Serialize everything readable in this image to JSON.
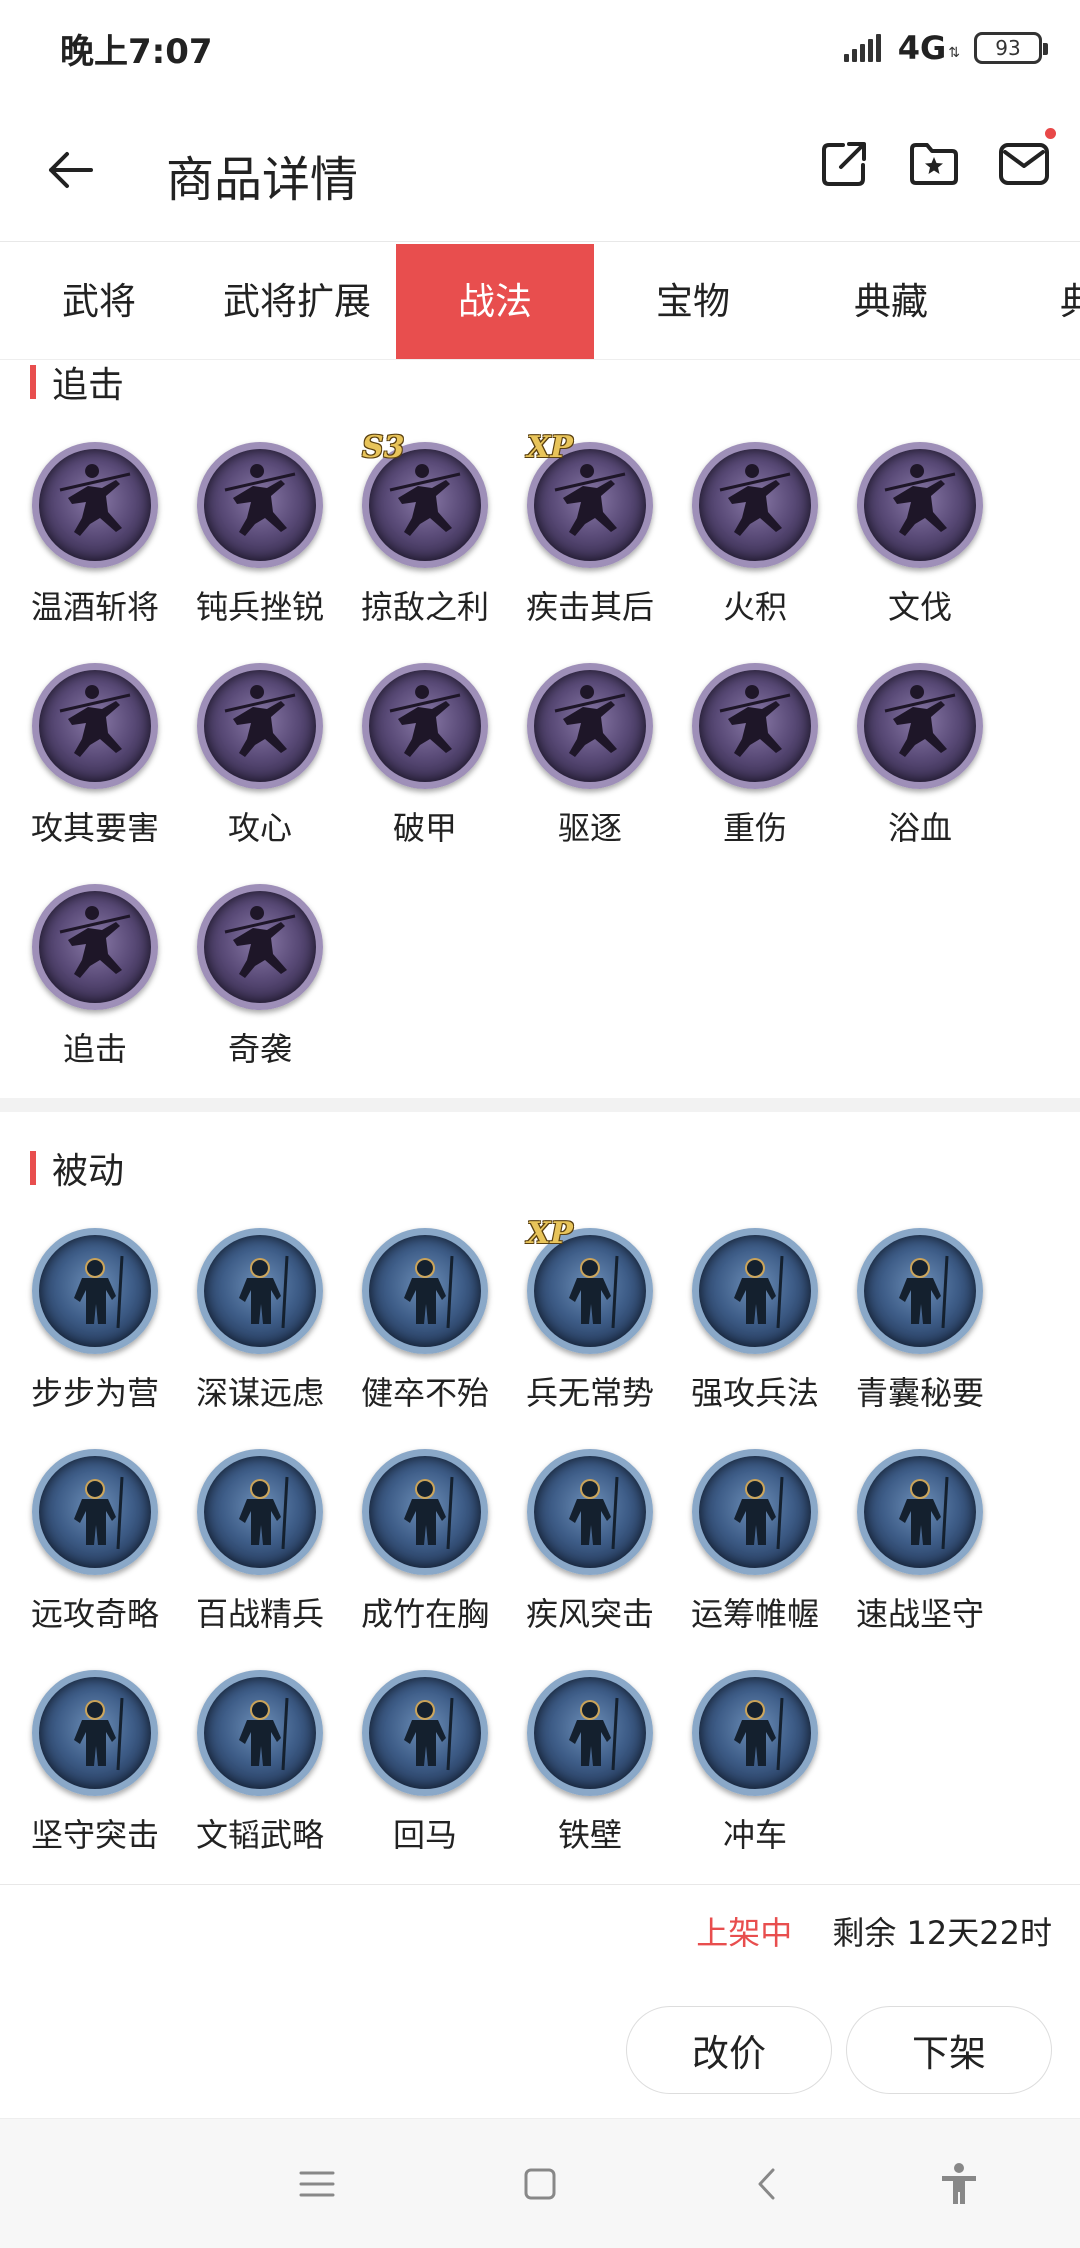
{
  "status_bar": {
    "time": "晚上7:07",
    "network": "4G",
    "battery": "93"
  },
  "header": {
    "title": "商品详情"
  },
  "tabs": [
    {
      "label": "武将"
    },
    {
      "label": "武将扩展"
    },
    {
      "label": "战法"
    },
    {
      "label": "宝物"
    },
    {
      "label": "典藏"
    },
    {
      "label": "典"
    }
  ],
  "active_tab": "战法",
  "sections": [
    {
      "title": "追击",
      "icon_color": "purple",
      "skills": [
        {
          "name": "温酒斩将",
          "badge": ""
        },
        {
          "name": "钝兵挫锐",
          "badge": ""
        },
        {
          "name": "掠敌之利",
          "badge": "S3"
        },
        {
          "name": "疾击其后",
          "badge": "XP"
        },
        {
          "name": "火积",
          "badge": ""
        },
        {
          "name": "文伐",
          "badge": ""
        },
        {
          "name": "攻其要害",
          "badge": ""
        },
        {
          "name": "攻心",
          "badge": ""
        },
        {
          "name": "破甲",
          "badge": ""
        },
        {
          "name": "驱逐",
          "badge": ""
        },
        {
          "name": "重伤",
          "badge": ""
        },
        {
          "name": "浴血",
          "badge": ""
        },
        {
          "name": "追击",
          "badge": ""
        },
        {
          "name": "奇袭",
          "badge": ""
        }
      ]
    },
    {
      "title": "被动",
      "icon_color": "blue",
      "skills": [
        {
          "name": "步步为营",
          "badge": ""
        },
        {
          "name": "深谋远虑",
          "badge": ""
        },
        {
          "name": "健卒不殆",
          "badge": ""
        },
        {
          "name": "兵无常势",
          "badge": "XP"
        },
        {
          "name": "强攻兵法",
          "badge": ""
        },
        {
          "name": "青囊秘要",
          "badge": ""
        },
        {
          "name": "远攻奇略",
          "badge": ""
        },
        {
          "name": "百战精兵",
          "badge": ""
        },
        {
          "name": "成竹在胸",
          "badge": ""
        },
        {
          "name": "疾风突击",
          "badge": ""
        },
        {
          "name": "运筹帷幄",
          "badge": ""
        },
        {
          "name": "速战坚守",
          "badge": ""
        },
        {
          "name": "坚守突击",
          "badge": ""
        },
        {
          "name": "文韬武略",
          "badge": ""
        },
        {
          "name": "回马",
          "badge": ""
        },
        {
          "name": "铁壁",
          "badge": ""
        },
        {
          "name": "冲车",
          "badge": ""
        }
      ]
    }
  ],
  "footer": {
    "status": "上架中",
    "remaining": "剩余  12天22时",
    "reprice_label": "改价",
    "delist_label": "下架"
  },
  "colors": {
    "accent": "#e84e4e"
  },
  "icons": {
    "back": "arrow-left-icon",
    "share": "share-icon",
    "favorite": "folder-star-icon",
    "mail": "mail-icon",
    "nav_menu": "menu-icon",
    "nav_home": "square-home-icon",
    "nav_back": "chevron-left-icon",
    "nav_accessibility": "accessibility-icon"
  }
}
